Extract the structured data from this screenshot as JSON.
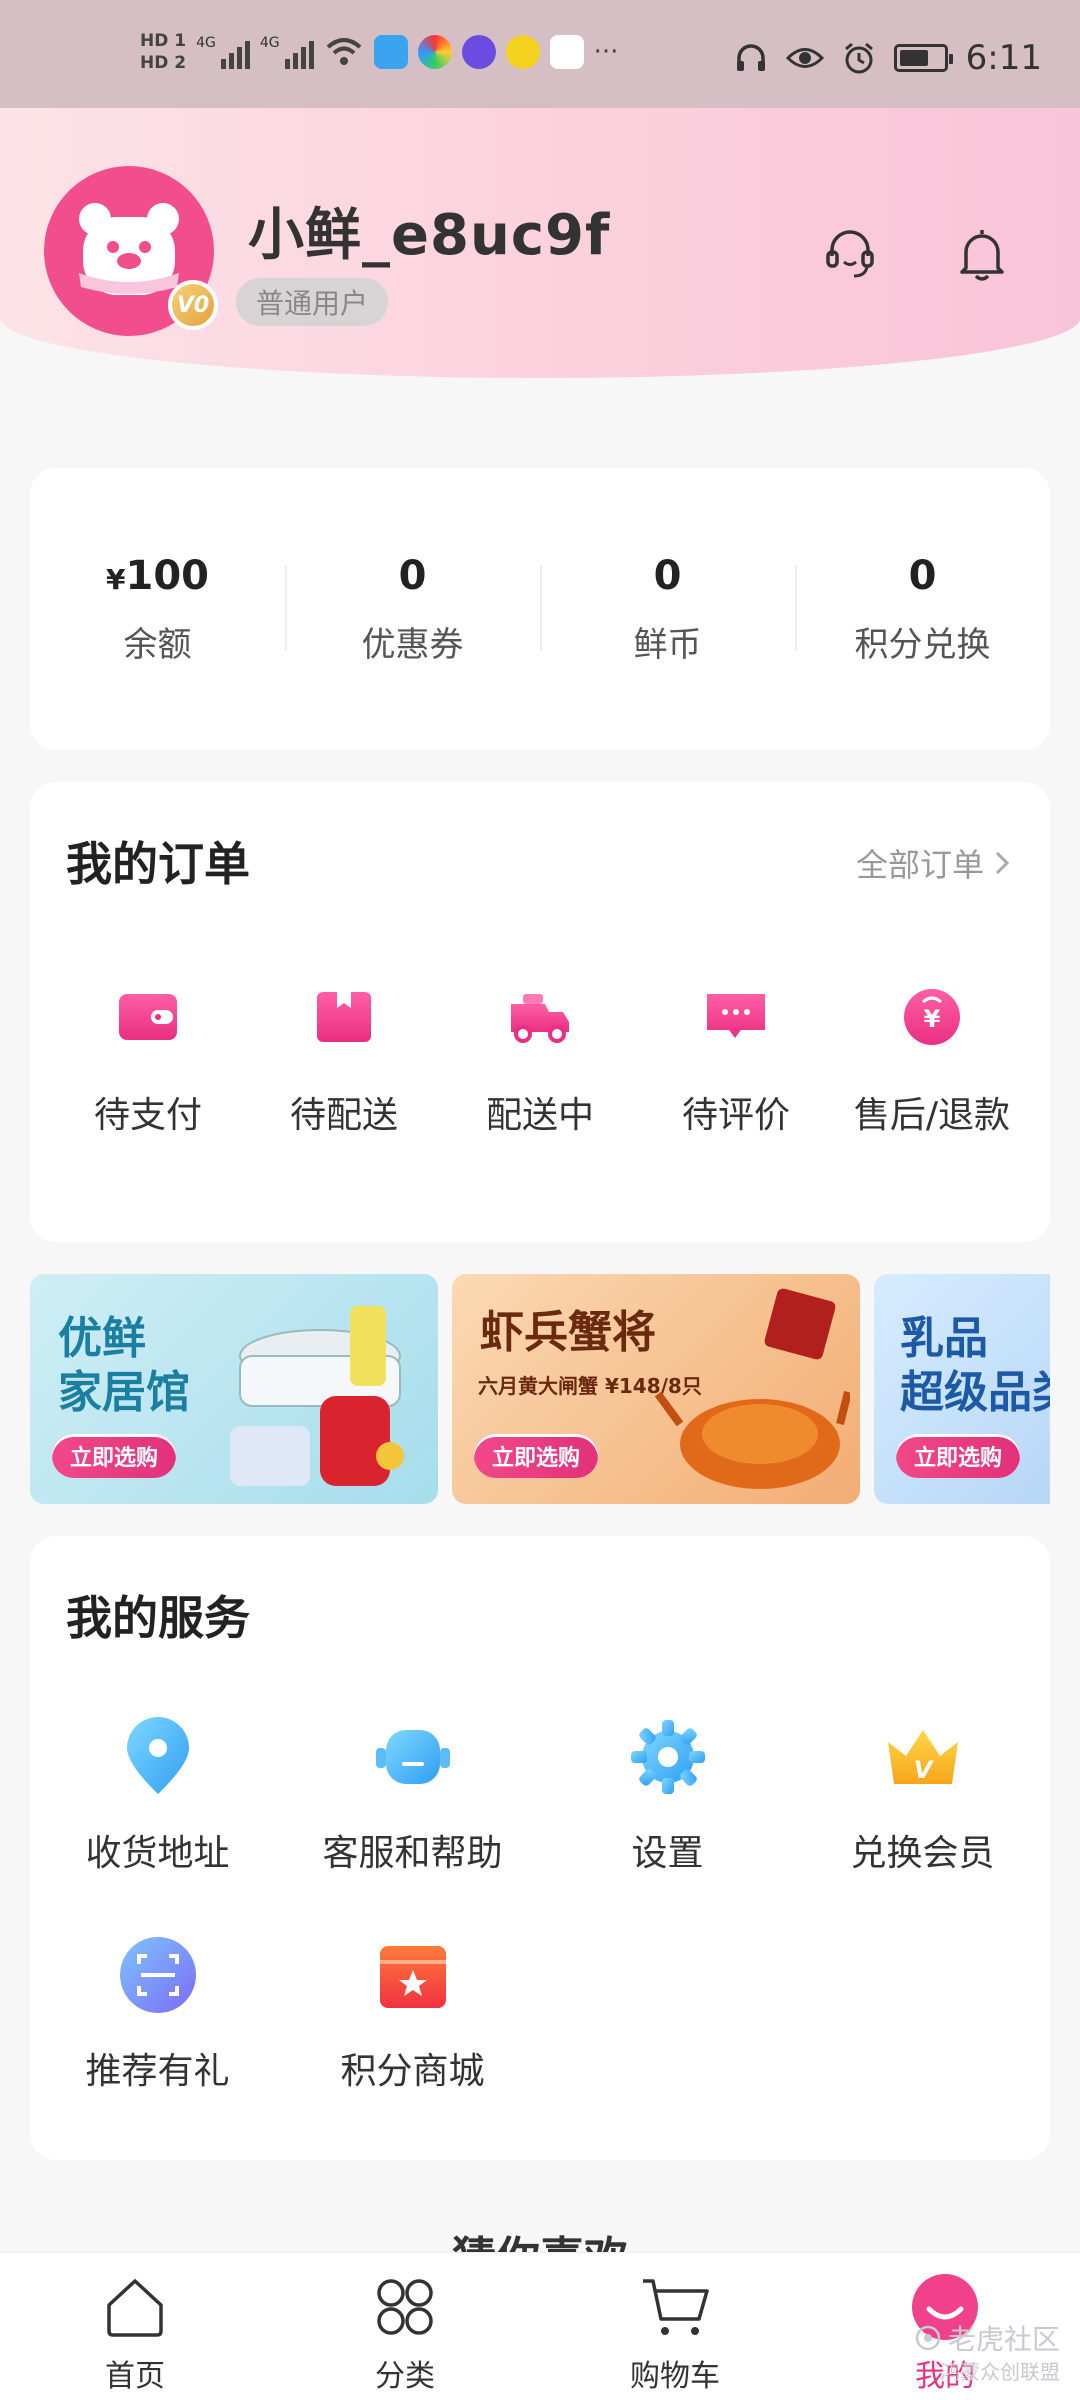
{
  "status_bar": {
    "time": "6:11",
    "network_labels": [
      "4G",
      "4G"
    ],
    "hd_labels": [
      "HD 1",
      "HD 2"
    ],
    "more": "···"
  },
  "profile": {
    "username": "小鲜_e8uc9f",
    "user_type": "普通用户",
    "level_badge": "V0",
    "icons": [
      "customer-service-icon",
      "bell-icon"
    ]
  },
  "stats": [
    {
      "value_prefix": "¥",
      "value": "100",
      "label": "余额"
    },
    {
      "value_prefix": "",
      "value": "0",
      "label": "优惠券"
    },
    {
      "value_prefix": "",
      "value": "0",
      "label": "鲜币"
    },
    {
      "value_prefix": "",
      "value": "0",
      "label": "积分兑换"
    }
  ],
  "orders": {
    "title": "我的订单",
    "all_label": "全部订单",
    "items": [
      {
        "label": "待支付",
        "icon": "wallet-icon"
      },
      {
        "label": "待配送",
        "icon": "package-icon"
      },
      {
        "label": "配送中",
        "icon": "delivery-truck-icon"
      },
      {
        "label": "待评价",
        "icon": "comment-icon"
      },
      {
        "label": "售后/退款",
        "icon": "refund-icon"
      }
    ]
  },
  "banners": [
    {
      "title_line1": "优鲜",
      "title_line2": "家居馆",
      "button": "立即选购"
    },
    {
      "title_line1": "虾兵蟹将",
      "subtitle": "六月黄大闸蟹 ¥148/8只",
      "button": "立即选购"
    },
    {
      "title_line1": "乳品",
      "title_line2": "超级品类",
      "button": "立即选购"
    }
  ],
  "services": {
    "title": "我的服务",
    "items": [
      {
        "label": "收货地址",
        "icon": "location-pin-icon"
      },
      {
        "label": "客服和帮助",
        "icon": "robot-support-icon"
      },
      {
        "label": "设置",
        "icon": "gear-icon"
      },
      {
        "label": "兑换会员",
        "icon": "crown-icon"
      },
      {
        "label": "推荐有礼",
        "icon": "scan-icon"
      },
      {
        "label": "积分商城",
        "icon": "store-icon"
      }
    ]
  },
  "recommend_title": "猜你喜欢",
  "tabbar": [
    {
      "label": "首页",
      "icon": "home-icon"
    },
    {
      "label": "分类",
      "icon": "category-icon"
    },
    {
      "label": "购物车",
      "icon": "cart-icon"
    },
    {
      "label": "我的",
      "icon": "profile-icon",
      "active": true
    }
  ],
  "watermark": {
    "main": "老虎社区",
    "sub": "鸿蒙众创联盟"
  },
  "colors": {
    "accent": "#f0418a",
    "header_bg": "#fbd0dd",
    "page_bg": "#f7f7f8"
  }
}
